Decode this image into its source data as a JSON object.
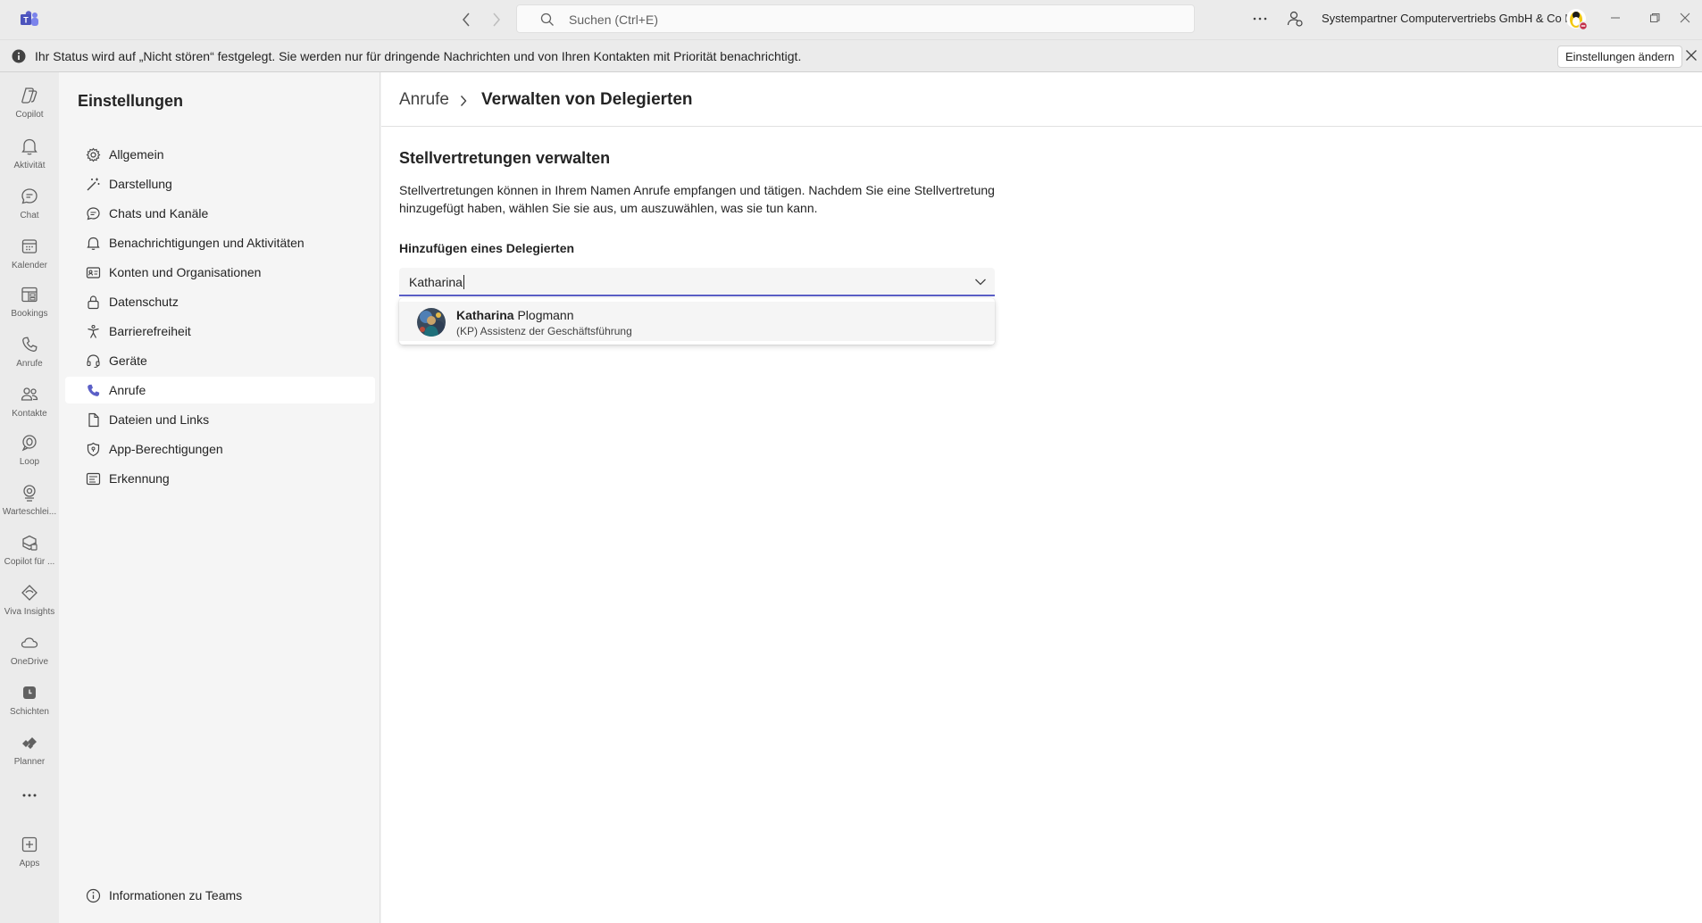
{
  "titlebar": {
    "search_placeholder": "Suchen (Ctrl+E)",
    "tenant_name": "Systempartner Computervertriebs GmbH & Co KG",
    "more_label": "Weitere Optionen"
  },
  "banner": {
    "message": "Ihr Status wird auf „Nicht stören“ festgelegt. Sie werden nur für dringende Nachrichten und von Ihren Kontakten mit Priorität benachrichtigt.",
    "button_label": "Einstellungen ändern"
  },
  "rail": {
    "items": [
      {
        "label": "Copilot",
        "icon": "copilot-icon"
      },
      {
        "label": "Aktivität",
        "icon": "bell-icon"
      },
      {
        "label": "Chat",
        "icon": "chat-icon"
      },
      {
        "label": "Kalender",
        "icon": "calendar-icon"
      },
      {
        "label": "Bookings",
        "icon": "bookings-icon"
      },
      {
        "label": "Anrufe",
        "icon": "phone-icon"
      },
      {
        "label": "Kontakte",
        "icon": "people-icon"
      },
      {
        "label": "Loop",
        "icon": "loop-icon"
      },
      {
        "label": "Warteschlei...",
        "icon": "queue-icon"
      },
      {
        "label": "Copilot für ...",
        "icon": "copilot-studio-icon"
      },
      {
        "label": "Viva Insights",
        "icon": "viva-insights-icon"
      },
      {
        "label": "OneDrive",
        "icon": "cloud-icon"
      },
      {
        "label": "Schichten",
        "icon": "shifts-icon"
      },
      {
        "label": "Planner",
        "icon": "planner-icon"
      },
      {
        "label": "",
        "icon": "more-icon"
      },
      {
        "label": "Apps",
        "icon": "add-apps-icon"
      }
    ]
  },
  "settings": {
    "title": "Einstellungen",
    "items": [
      {
        "label": "Allgemein",
        "icon": "gear-icon"
      },
      {
        "label": "Darstellung",
        "icon": "wand-icon"
      },
      {
        "label": "Chats und Kanäle",
        "icon": "chat-bubble-icon"
      },
      {
        "label": "Benachrichtigungen und Aktivitäten",
        "icon": "bell-icon"
      },
      {
        "label": "Konten und Organisationen",
        "icon": "id-card-icon"
      },
      {
        "label": "Datenschutz",
        "icon": "lock-icon"
      },
      {
        "label": "Barrierefreiheit",
        "icon": "accessibility-icon"
      },
      {
        "label": "Geräte",
        "icon": "headset-icon"
      },
      {
        "label": "Anrufe",
        "icon": "phone-icon"
      },
      {
        "label": "Dateien und Links",
        "icon": "document-icon"
      },
      {
        "label": "App-Berechtigungen",
        "icon": "shield-icon"
      },
      {
        "label": "Erkennung",
        "icon": "recognition-icon"
      }
    ],
    "active_index": 8,
    "about_label": "Informationen zu Teams"
  },
  "main": {
    "breadcrumb_root": "Anrufe",
    "breadcrumb_current": "Verwalten von Delegierten",
    "section_title": "Stellvertretungen verwalten",
    "section_description": "Stellvertretungen können in Ihrem Namen Anrufe empfangen und tätigen. Nachdem Sie eine Stellvertretung hinzugefügt haben, wählen Sie sie aus, um auszuwählen, was sie tun kann.",
    "add_label": "Hinzufügen eines Delegierten",
    "combo_value": "Katharina",
    "suggestion": {
      "name_match": "Katharina",
      "name_rest": " Plogmann",
      "subtitle": "(KP) Assistenz der Geschäftsführung"
    }
  },
  "colors": {
    "accent": "#5b5fc7",
    "teams_logo": "#5b5fc7",
    "busy_status": "#c4314b"
  }
}
